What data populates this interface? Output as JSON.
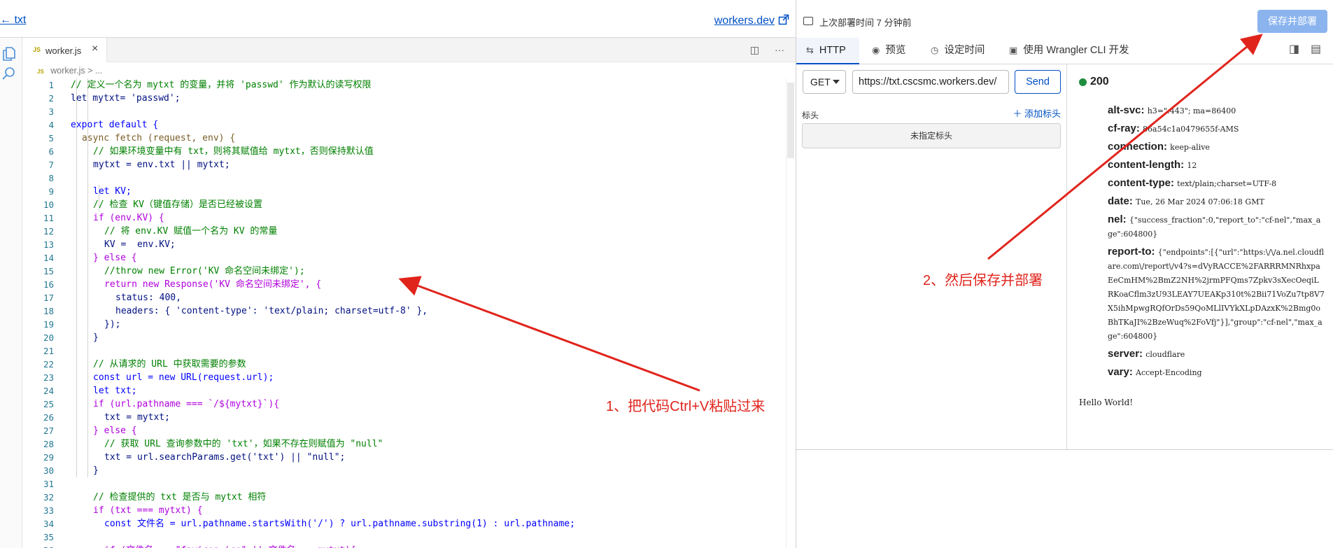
{
  "left_header": {
    "back_label": "← txt",
    "workers_link": "workers.dev"
  },
  "editor": {
    "tab_label": "worker.js",
    "breadcrumb": "worker.js",
    "breadcrumb_more": "> ...",
    "code_lines": [
      {
        "n": "1",
        "i": 0,
        "c": "#008000",
        "t": "// 定义一个名为 mytxt 的变量，并将 'passwd' 作为默认的读写权限"
      },
      {
        "n": "2",
        "i": 0,
        "c": "#001080",
        "t": "let mytxt= 'passwd';"
      },
      {
        "n": "3",
        "i": 0,
        "c": "#001080",
        "t": ""
      },
      {
        "n": "4",
        "i": 0,
        "c": "#0000ff",
        "t": "export default {"
      },
      {
        "n": "5",
        "i": 1,
        "c": "#795e26",
        "t": "async fetch (request, env) {"
      },
      {
        "n": "6",
        "i": 2,
        "c": "#008000",
        "t": "// 如果环境变量中有 txt，则将其赋值给 mytxt，否则保持默认值"
      },
      {
        "n": "7",
        "i": 2,
        "c": "#001080",
        "t": "mytxt = env.txt || mytxt;"
      },
      {
        "n": "8",
        "i": 2,
        "c": "#001080",
        "t": ""
      },
      {
        "n": "9",
        "i": 2,
        "c": "#0000ff",
        "t": "let KV;"
      },
      {
        "n": "10",
        "i": 2,
        "c": "#008000",
        "t": "// 检查 KV（键值存储）是否已经被设置"
      },
      {
        "n": "11",
        "i": 2,
        "c": "#af00db",
        "t": "if (env.KV) {"
      },
      {
        "n": "12",
        "i": 3,
        "c": "#008000",
        "t": "// 将 env.KV 赋值一个名为 KV 的常量"
      },
      {
        "n": "13",
        "i": 3,
        "c": "#001080",
        "t": "KV =  env.KV;"
      },
      {
        "n": "14",
        "i": 2,
        "c": "#af00db",
        "t": "} else {"
      },
      {
        "n": "15",
        "i": 3,
        "c": "#008000",
        "t": "//throw new Error('KV 命名空间未绑定');"
      },
      {
        "n": "16",
        "i": 3,
        "c": "#af00db",
        "t": "return new Response('KV 命名空间未绑定', {"
      },
      {
        "n": "17",
        "i": 4,
        "c": "#001080",
        "t": "status: 400,"
      },
      {
        "n": "18",
        "i": 4,
        "c": "#001080",
        "t": "headers: { 'content-type': 'text/plain; charset=utf-8' },"
      },
      {
        "n": "19",
        "i": 3,
        "c": "#001080",
        "t": "});"
      },
      {
        "n": "20",
        "i": 2,
        "c": "#001080",
        "t": "}"
      },
      {
        "n": "21",
        "i": 2,
        "c": "#001080",
        "t": ""
      },
      {
        "n": "22",
        "i": 2,
        "c": "#008000",
        "t": "// 从请求的 URL 中获取需要的参数"
      },
      {
        "n": "23",
        "i": 2,
        "c": "#0000ff",
        "t": "const url = new URL(request.url);"
      },
      {
        "n": "24",
        "i": 2,
        "c": "#0000ff",
        "t": "let txt;"
      },
      {
        "n": "25",
        "i": 2,
        "c": "#af00db",
        "t": "if (url.pathname === `/${mytxt}`){"
      },
      {
        "n": "26",
        "i": 3,
        "c": "#001080",
        "t": "txt = mytxt;"
      },
      {
        "n": "27",
        "i": 2,
        "c": "#af00db",
        "t": "} else {"
      },
      {
        "n": "28",
        "i": 3,
        "c": "#008000",
        "t": "// 获取 URL 查询参数中的 'txt'，如果不存在则赋值为 \"null\""
      },
      {
        "n": "29",
        "i": 3,
        "c": "#001080",
        "t": "txt = url.searchParams.get('txt') || \"null\";"
      },
      {
        "n": "30",
        "i": 2,
        "c": "#001080",
        "t": "}"
      },
      {
        "n": "31",
        "i": 2,
        "c": "#001080",
        "t": ""
      },
      {
        "n": "32",
        "i": 2,
        "c": "#008000",
        "t": "// 检查提供的 txt 是否与 mytxt 相符"
      },
      {
        "n": "33",
        "i": 2,
        "c": "#af00db",
        "t": "if (txt === mytxt) {"
      },
      {
        "n": "34",
        "i": 3,
        "c": "#0000ff",
        "t": "const 文件名 = url.pathname.startsWith('/') ? url.pathname.substring(1) : url.pathname;"
      },
      {
        "n": "35",
        "i": 3,
        "c": "#001080",
        "t": ""
      },
      {
        "n": "36",
        "i": 3,
        "c": "#af00db",
        "t": "if (文件名 == \"favicon.ico\" || 文件名 == mytxt){"
      }
    ]
  },
  "right_header": {
    "deploy_time": "上次部署时间 7 分钟前",
    "deploy_button": "保存并部署"
  },
  "right_tabs": {
    "http": "HTTP",
    "preview": "预览",
    "schedule": "设定时间",
    "wrangler": "使用 Wrangler CLI 开发"
  },
  "request": {
    "method": "GET",
    "url": "https://txt.cscsmc.workers.dev/",
    "send": "Send",
    "headers_label": "标头",
    "add_header": "添加标头",
    "no_headers": "未指定标头"
  },
  "response": {
    "status": "200",
    "headers": [
      {
        "key": "alt-svc:",
        "value": "h3=\":443\"; ma=86400"
      },
      {
        "key": "cf-ray:",
        "value": "86a54c1a0479655f-AMS"
      },
      {
        "key": "connection:",
        "value": "keep-alive"
      },
      {
        "key": "content-length:",
        "value": "12"
      },
      {
        "key": "content-type:",
        "value": "text/plain;charset=UTF-8"
      },
      {
        "key": "date:",
        "value": "Tue, 26 Mar 2024 07:06:18 GMT"
      },
      {
        "key": "nel:",
        "value": "{\"success_fraction\":0,\"report_to\":\"cf-nel\",\"max_age\":604800}"
      },
      {
        "key": "report-to:",
        "value": "{\"endpoints\":[{\"url\":\"https:\\/\\/a.nel.cloudflare.com\\/report\\/v4?s=dVyRACCE%2FARRRMNRhxpaEeCmHM%2BmZ2NH%2jrmPFQms7Zpkv3sXecOeqiLRKoaCflm3zU93LEAY7UEAKp310t%2Bii71VoZu7tp8V7X5ihMpwgRQfOrDs59QoMLlIVYkXLpDAzxK%2Bmg0oBhTKaJI%2BzeWuq%2FoVfj\"}],\"group\":\"cf-nel\",\"max_age\":604800}"
      },
      {
        "key": "server:",
        "value": "cloudflare"
      },
      {
        "key": "vary:",
        "value": "Accept-Encoding"
      }
    ],
    "body": "Hello World!"
  },
  "annotations": {
    "step1": "1、把代码Ctrl+V粘贴过来",
    "step2": "2、然后保存并部署",
    "color": "#e0241c"
  }
}
